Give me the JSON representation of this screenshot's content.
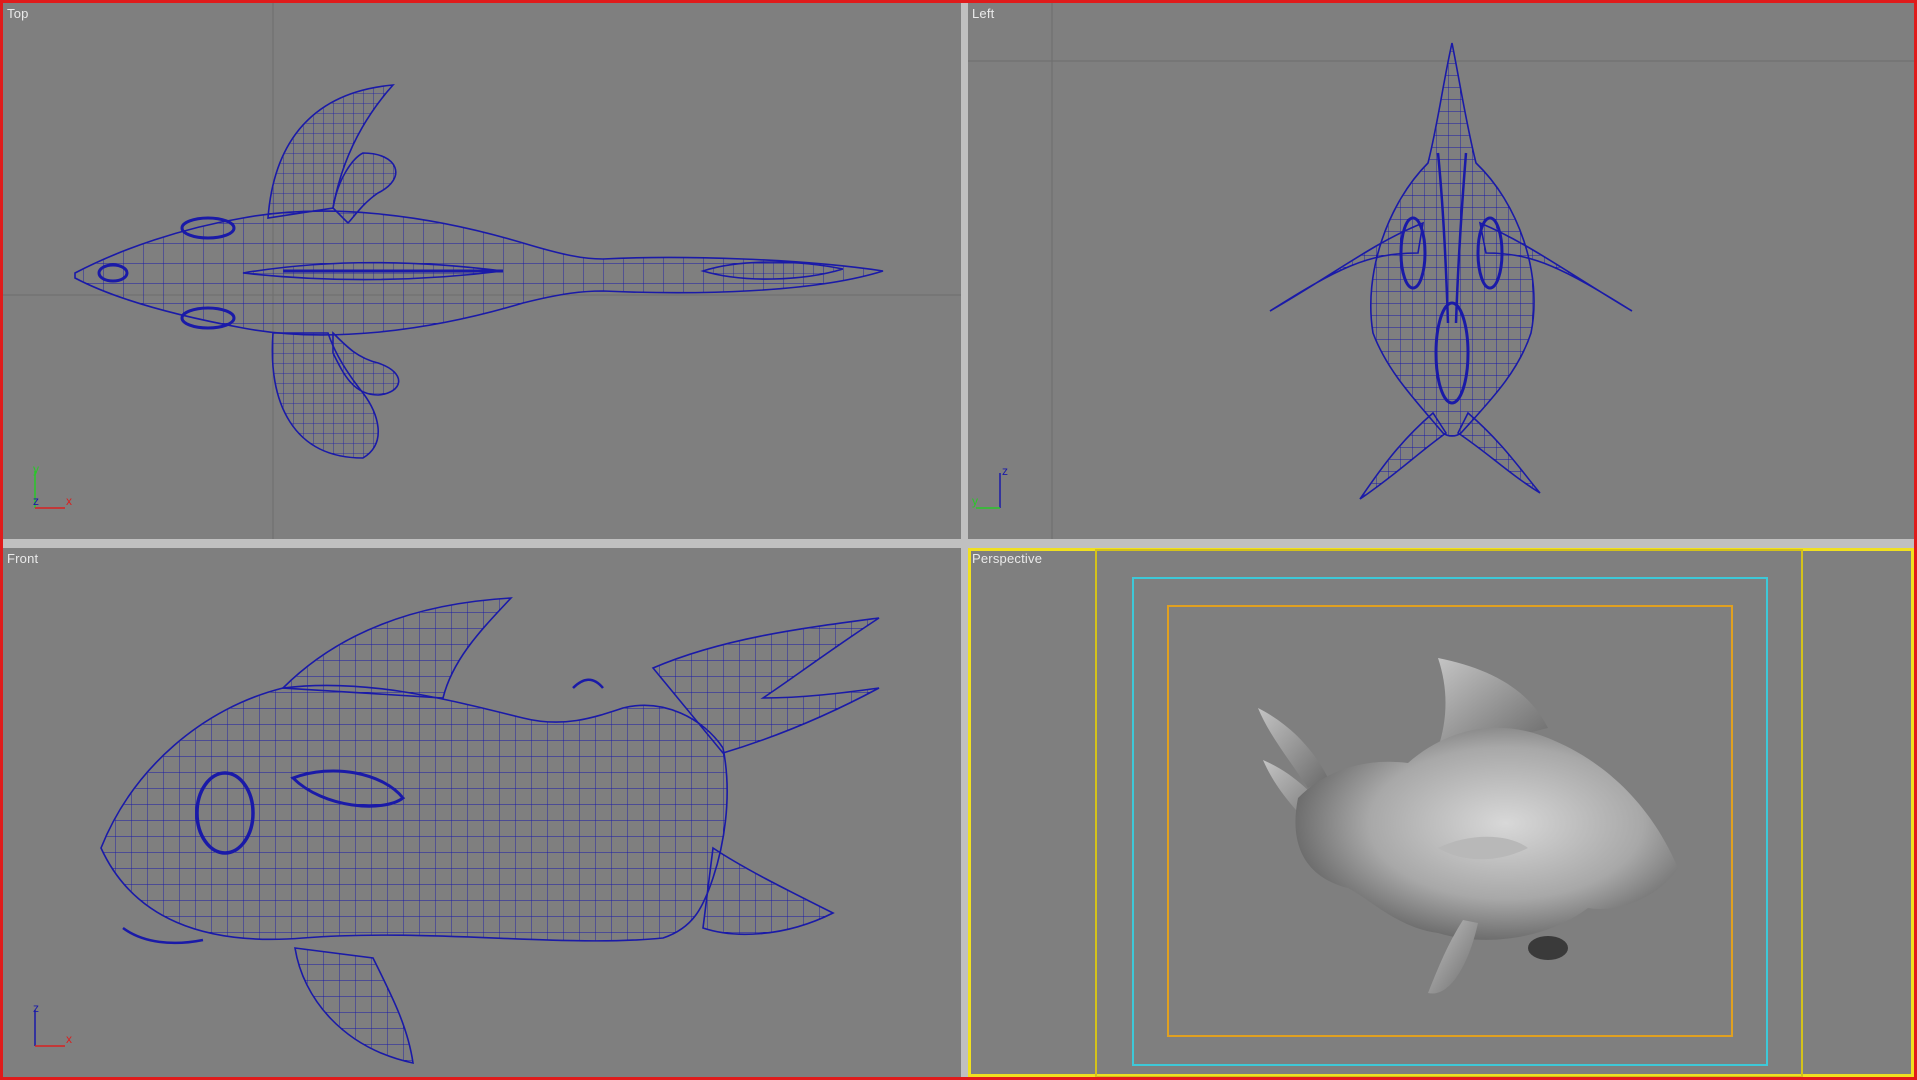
{
  "viewports": {
    "top": {
      "label": "Top"
    },
    "left": {
      "label": "Left"
    },
    "front": {
      "label": "Front"
    },
    "perspective": {
      "label": "Perspective"
    }
  },
  "axis_gizmos": {
    "top": {
      "vertical": "y",
      "depth": "z",
      "horizontal": "x"
    },
    "left": {
      "vertical": "z",
      "horizontal": "y"
    },
    "front": {
      "vertical": "z",
      "horizontal": "x"
    }
  },
  "colors": {
    "viewport_bg": "#7f7f7f",
    "wireframe": "#1a1aa8",
    "active_viewport_border": "#f0e020",
    "app_border": "#e01b1b",
    "safe_frame_outer": "#d4c21a",
    "safe_frame_action": "#3ec8d8",
    "safe_frame_title": "#e0a020"
  }
}
